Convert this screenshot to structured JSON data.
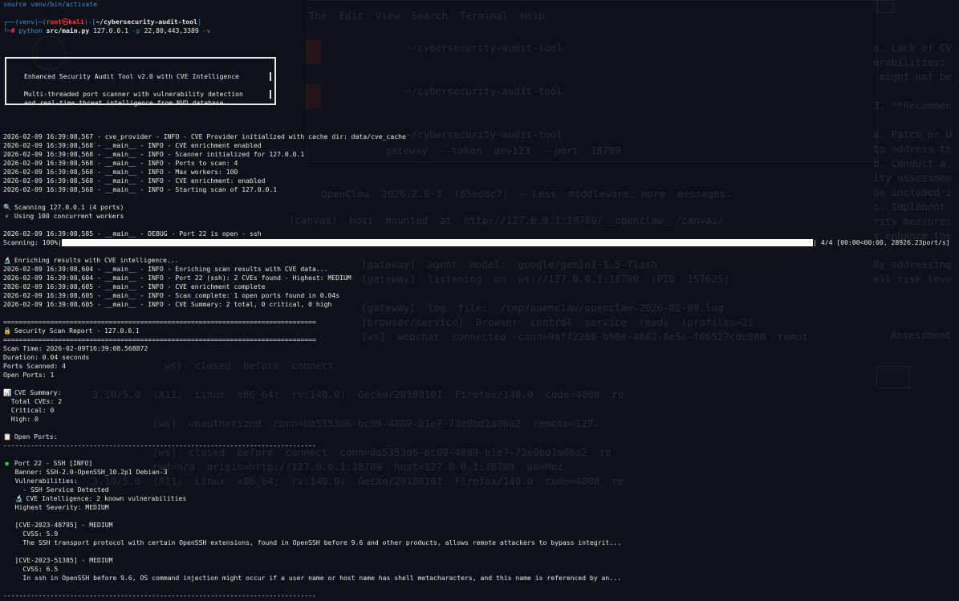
{
  "ghost_text": {
    "r1": "The  Edit  View  Search  Terminal  Help",
    "r2": "~/cybersecurity-audit-tool",
    "r3": "~/cybersecurity-audit-tool",
    "r4": "~/cybersecurity-audit-tool",
    "r5": "gateway  --token  dev123  --port  18789",
    "r6": "OpenClaw  2026.2.6-3  (85ed6c7)  — Less  middleware, more  messages.",
    "r7": "[canvas]  host  mounted  at  http://127.0.0.1:18789/__openclaw__/canvas/",
    "r8": "[gateway]  agent  model:  google/gemini-1.5-flash",
    "r9": "[gateway]  listening  on  ws://127.0.0.1:18789  (PID  157625)",
    "r10": "[gateway]  log  file:  /tmp/openclaw/openclaw-2026-02-09.log",
    "r11": "[browser/service]  Browser  control  service  ready  (profiles=2)",
    "r12": "[ws]  webchat  connected  conn=9aff2260-b66e-4862-8e5c-f06527c0c880  remot",
    "r13": "ws]  closed  before  connect",
    "r14": "3.10/5.0  (X11;  Linux  x86_64;  rv:140.0)  Gecko/20100101  Firefox/140.0  code=4008  re",
    "r15": "[ws]  unauthorized  conn=0a5353d6-bc09-4889-b1e7-73e0bd1a06a2  remote=127.",
    "r16": "[ws]  closed  before  connect  conn=0a5353d6-bc09-4889-b1e7-73e0bd1a06a2  re",
    "r17": "rwd=n/a  origin=http://127.0.0.1:18789  host=127.0.0.1:18789  ua=Moz",
    "r18": "3.10/5.0  (X11;  Linux  x86_64;  rv:140.0)  Gecko/20100101  Firefox/140.0  code=4008  re",
    "c1": "c. Lack of CV",
    "c2": "erabilities;",
    "c3": " might not be",
    "c4": "3. **Recommen",
    "c5": "a. Patch or U",
    "c6": "to address th",
    "c7": "b. Conduct a",
    "c8": "ity assessmen",
    "c9": "be included i",
    "c10": "c. Implement",
    "c11": "rity measures",
    "c12": "r enhance the",
    "c13": "By addressing",
    "c14": "all risk leve",
    "c15": "Assessment"
  },
  "terminal": {
    "cmd1": "source venv/bin/activate",
    "prompt_venv": "(venv)",
    "prompt_user": "root",
    "prompt_host": "kali",
    "prompt_dir": "~/cybersecurity-audit-tool",
    "cmd_python": "python",
    "cmd_script": "src/main.py",
    "cmd_args": "127.0.0.1",
    "cmd_flag_p": "-p",
    "cmd_ports": "22,80,443,3389",
    "cmd_flag_v": "-v",
    "banner_l1": "Enhanced Security Audit Tool v2.0 with CVE Intelligence",
    "banner_l2": "Multi-threaded port scanner with vulnerability detection",
    "banner_l3": "and real-time threat intelligence from NVD database",
    "log1": "2026-02-09 16:39:08,567 - cve_provider - INFO - CVE Provider initialized with cache dir: data/cve_cache",
    "log2": "2026-02-09 16:39:08,568 - __main__ - INFO - CVE enrichment enabled",
    "log3": "2026-02-09 16:39:08,568 - __main__ - INFO - Scanner initialized for 127.0.0.1",
    "log4": "2026-02-09 16:39:08,568 - __main__ - INFO - Ports to scan: 4",
    "log5": "2026-02-09 16:39:08,568 - __main__ - INFO - Max workers: 100",
    "log6": "2026-02-09 16:39:08,568 - __main__ - INFO - CVE enrichment: enabled",
    "log7": "2026-02-09 16:39:08,568 - __main__ - INFO - Starting scan of 127.0.0.1",
    "scanning": "Scanning 127.0.0.1 (4 ports)",
    "workers": "Using 100 concurrent workers",
    "debug": "2026-02-09 16:39:08,585 - __main__ - DEBUG - Port 22 is open - ssh",
    "progress_label": "Scanning: 100%|",
    "progress_value": 1.0,
    "progress_tail": "| 4/4 [00:00<00:00, 28926.23port/s]",
    "enrich": "Enriching results with CVE intelligence...",
    "log8": "2026-02-09 16:39:08,604 - __main__ - INFO - Enriching scan results with CVE data...",
    "log9": "2026-02-09 16:39:08,604 - __main__ - INFO - Port 22 (ssh): 2 CVEs found - Highest: MEDIUM",
    "log10": "2026-02-09 16:39:08,605 - __main__ - INFO - CVE enrichment complete",
    "log11": "2026-02-09 16:39:08,605 - __main__ - INFO - Scan complete: 1 open ports found in 0.04s",
    "log12": "2026-02-09 16:39:08,605 - __main__ - INFO - CVE Summary: 2 total, 0 critical, 0 high",
    "separator": "================================================================================",
    "separator_dash": "--------------------------------------------------------------------------------",
    "report_title": "Security Scan Report - 127.0.0.1",
    "scan_time": "Scan Time: 2026-02-09T16:39:08.568872",
    "duration": "Duration: 0.04 seconds",
    "ports_scanned": "Ports Scanned: 4",
    "open_ports": "Open Ports: 1",
    "cve_summary": "CVE Summary:",
    "total_cves": "  Total CVEs: 2",
    "critical": "  Critical: 0",
    "high": "  High: 0",
    "open_ports_hdr": "Open Ports:",
    "port_line": "Port 22 - SSH [INFO]",
    "banner_line": "   Banner: SSH-2.0-OpenSSH_10.2p1 Debian-3",
    "vulns": "   Vulnerabilities:",
    "vuln1": "     - SSH Service Detected",
    "cve_intel": "CVE Intelligence: 2 known vulnerabilities",
    "highest": "   Highest Severity: MEDIUM",
    "cve1_id": "   [CVE-2023-48795] - MEDIUM",
    "cve1_score": "     CVSS: 5.9",
    "cve1_desc": "     The SSH transport protocol with certain OpenSSH extensions, found in OpenSSH before 9.6 and other products, allows remote attackers to bypass integrit...",
    "cve2_id": "   [CVE-2023-51385] - MEDIUM",
    "cve2_score": "     CVSS: 6.5",
    "cve2_desc": "     In ssh in OpenSSH before 9.6, OS command injection might occur if a user name or host name has shell metacharacters, and this name is referenced by an..."
  },
  "icons": {
    "search": "🔍",
    "lightning": "⚡",
    "microscope": "🔬",
    "lock": "🔒",
    "chart": "📊",
    "clipboard": "📋",
    "green_circle": "●"
  },
  "colors": {
    "prompt_blue": "#3d8ee0",
    "prompt_red": "#ff3b3b",
    "background": "#0e1117",
    "text": "#e6e6e6",
    "status_green": "#3fb950"
  }
}
